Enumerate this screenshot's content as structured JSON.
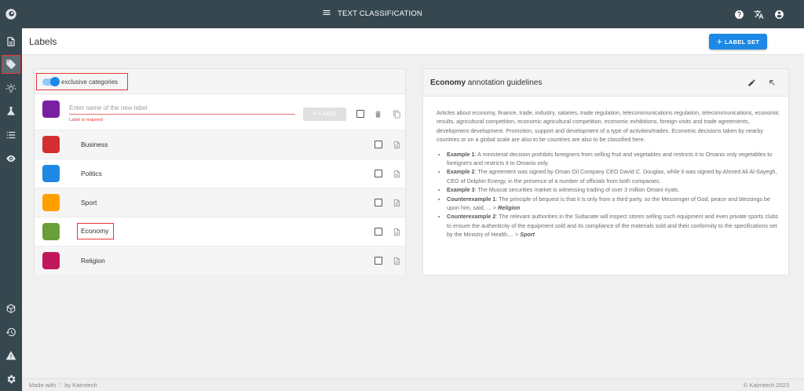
{
  "topbar": {
    "title": "TEXT CLASSIFICATION",
    "icons": [
      "help-icon",
      "translate-icon",
      "account-icon"
    ]
  },
  "sidebar": {
    "items": [
      "logo-icon",
      "documents-icon",
      "labels-icon",
      "ideas-icon",
      "experiments-icon",
      "list-icon",
      "eye-icon",
      "box-icon",
      "history-icon",
      "warning-icon",
      "settings-icon"
    ],
    "active": "labels-icon"
  },
  "header": {
    "title": "Labels",
    "label_set_button": "LABEL SET",
    "accent_color": "#1e88e5"
  },
  "labels_panel": {
    "toggle_label": "exclusive categories",
    "toggle_on": true,
    "new_label": {
      "placeholder": "Enter name of the new label",
      "error": "Label is required",
      "add_button": "LABEL",
      "color": "#7b1fa2"
    },
    "labels": [
      {
        "name": "Business",
        "color": "#d32f2f"
      },
      {
        "name": "Politics",
        "color": "#1e88e5"
      },
      {
        "name": "Sport",
        "color": "#ffa000"
      },
      {
        "name": "Economy",
        "color": "#689f38"
      },
      {
        "name": "Religion",
        "color": "#c2185b"
      }
    ],
    "selected_label": "Economy"
  },
  "guidelines": {
    "title_bold": "Economy",
    "title_rest": " annotation guidelines",
    "intro": "Articles about economy, finance, trade, industry, salaries, trade regulation, telecommunications regulation, telecommunications, economic results, agricultural competition, economic agricultural competition, economic exhibitions, foreign visits and trade agreements, development development. Promotion, support and development of a type of activities/trades. Economic decisions taken by nearby countries or on a global scale are also to be countries are also to be classified here.",
    "items": [
      {
        "label": "Example 1",
        "text": ": A ministerial decision prohibits foreigners from selling fruit and vegetables and restricts it to Omanis only vegetables to foreigners and restricts it to Omanis only.",
        "tag": ""
      },
      {
        "label": "Example 2",
        "text": ": The agreement was signed by Oman Oil Company CEO David C. Douglas, while it was signed by Ahmed Ali Al-Sayegh, CEO of Dolphin Energy, in the presence of a number of officials from both companies.",
        "tag": ""
      },
      {
        "label": "Example 3",
        "text": ": The Muscat securities market is witnessing trading of over 3 million Omani riyals.",
        "tag": ""
      },
      {
        "label": "Counterexample 1",
        "text": ": The principle of bequest is that it is only from a third party, so the Messenger of God, peace and blessings be upon him, said, ... > ",
        "tag": "Religion"
      },
      {
        "label": "Counterexample 2",
        "text": ": The relevant authorities in the Sultanate will inspect stores selling such equipment and even private sports clubs to ensure the authenticity of the equipment sold and its compliance of the materials sold and their conformity to the specifications set by the Ministry of Health.... > ",
        "tag": "Sport"
      }
    ]
  },
  "footer": {
    "left": "Made with ♡ by Kairntech",
    "right": "©    Kairntech 2023"
  }
}
